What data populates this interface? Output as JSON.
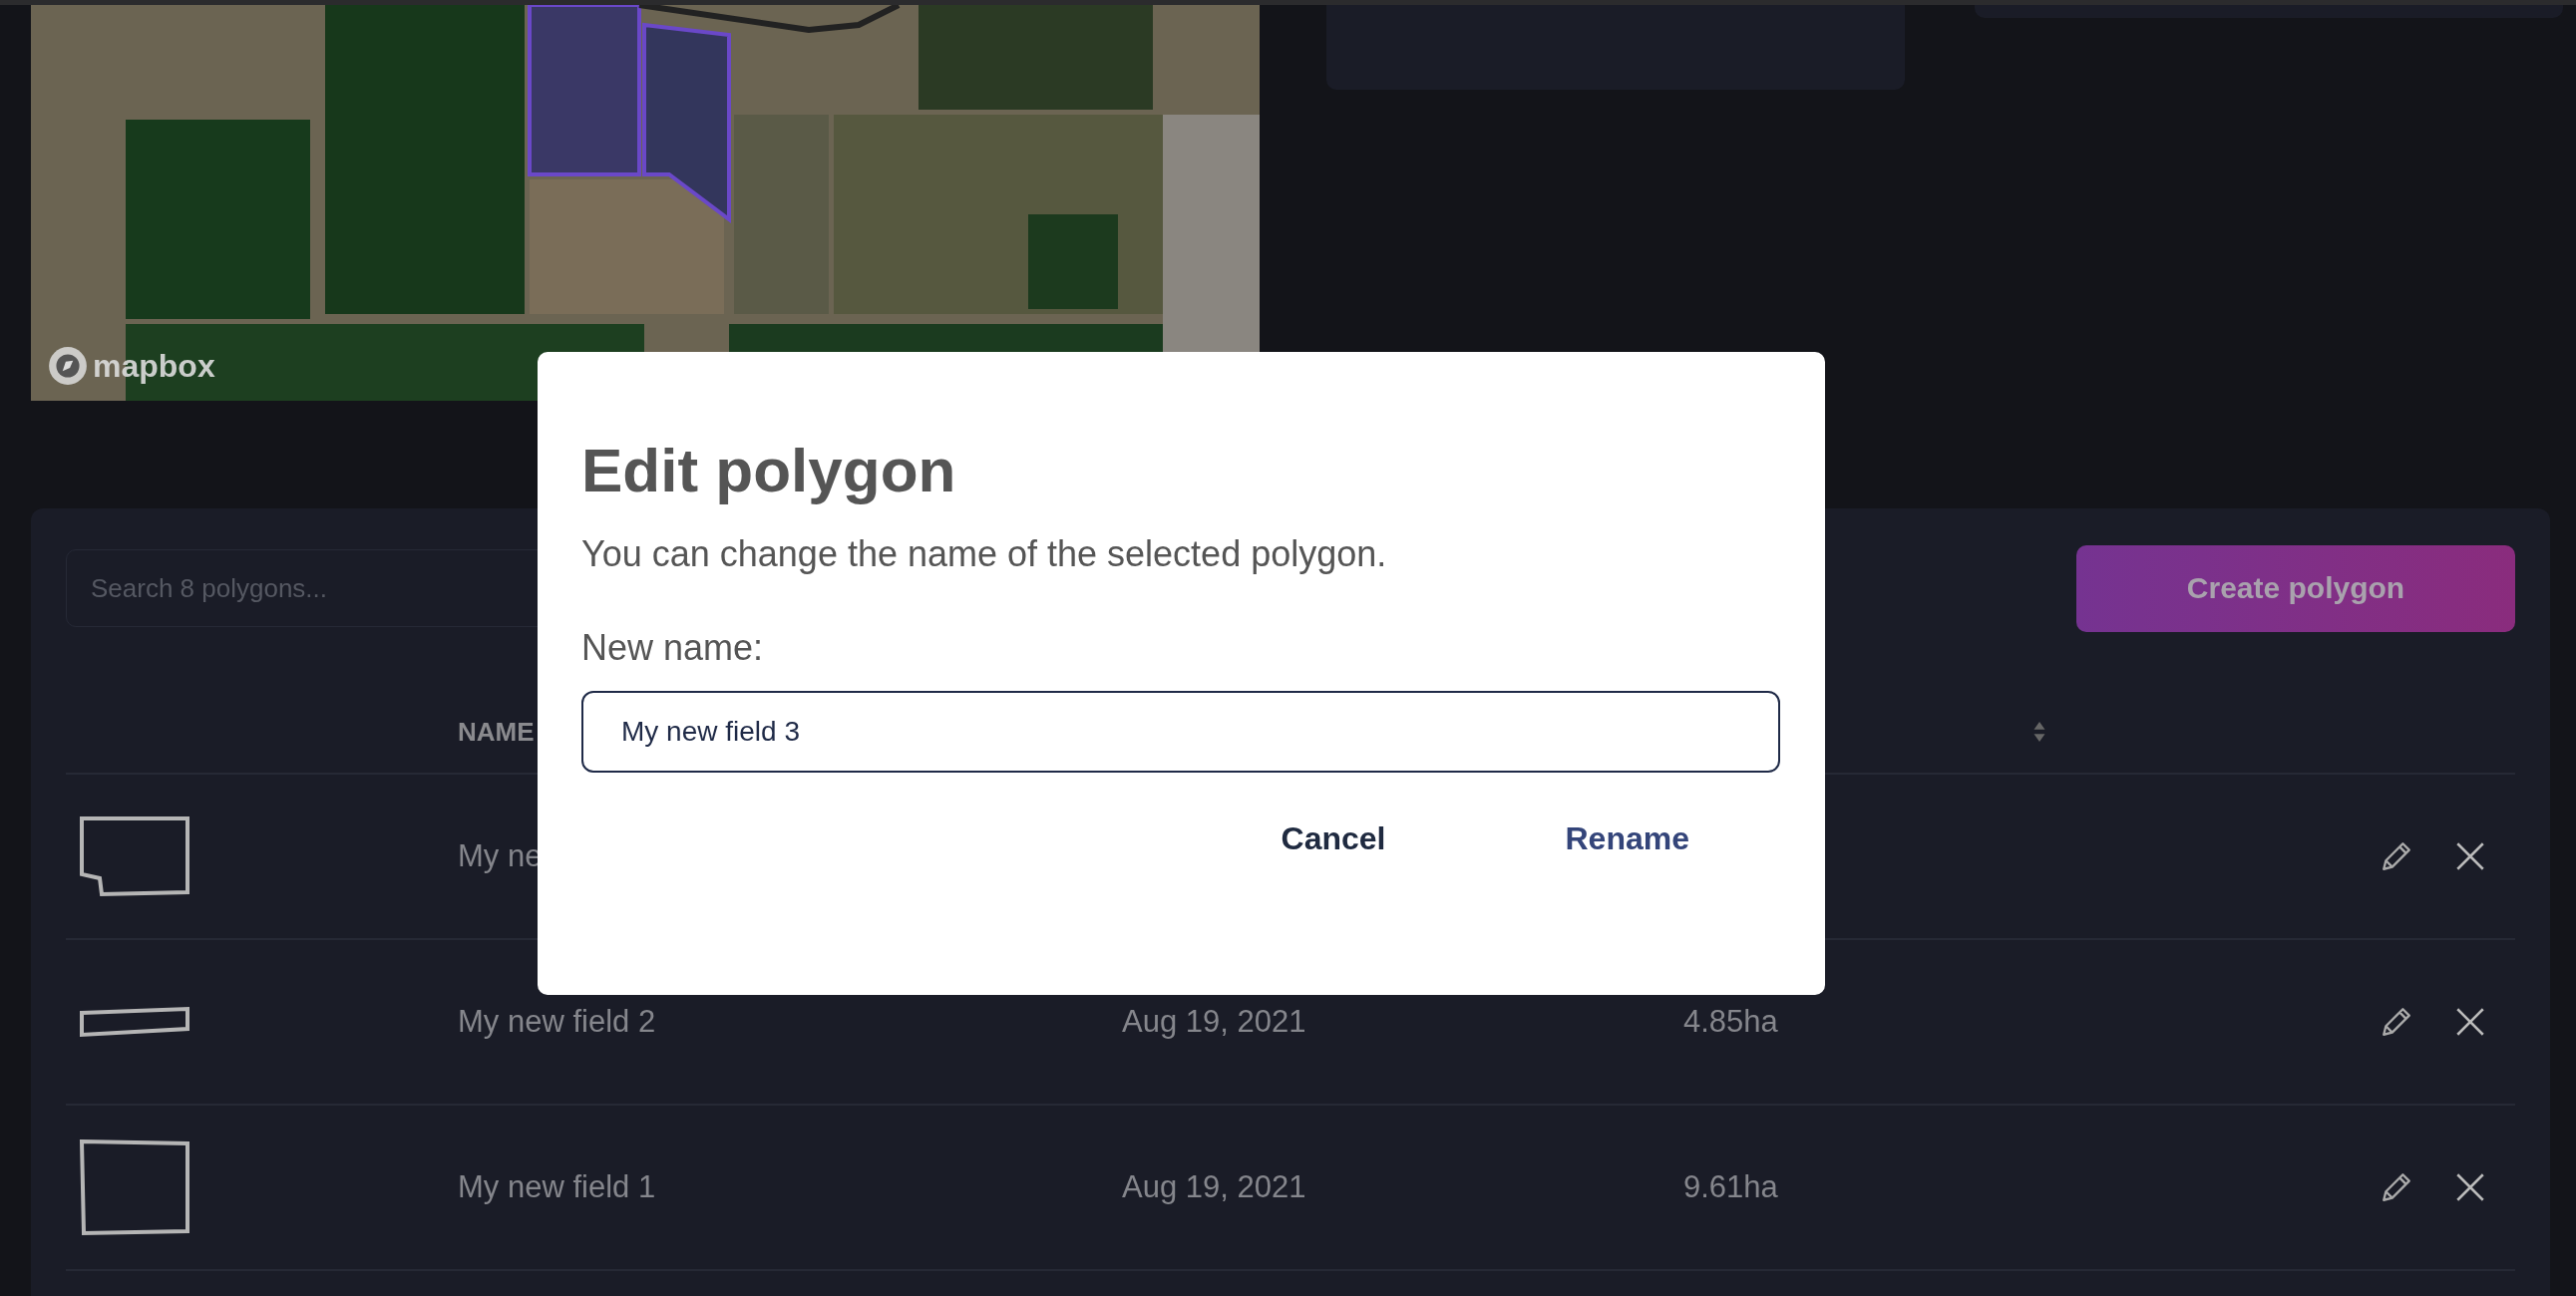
{
  "map": {
    "attribution": "mapbox"
  },
  "search": {
    "placeholder": "Search 8 polygons..."
  },
  "create_button": "Create polygon",
  "table": {
    "name_header": "NAME",
    "rows": [
      {
        "name": "My ne"
      },
      {
        "name": "My new field 2",
        "date": "Aug 19, 2021",
        "area": "4.85ha"
      },
      {
        "name": "My new field 1",
        "date": "Aug 19, 2021",
        "area": "9.61ha"
      }
    ]
  },
  "modal": {
    "title": "Edit polygon",
    "description": "You can change the name of the selected polygon.",
    "field_label": "New name:",
    "value": "My new field 3",
    "buttons": [
      {
        "label": "Cancel",
        "kind": "secondary"
      },
      {
        "label": "Rename",
        "kind": "primary"
      }
    ]
  }
}
